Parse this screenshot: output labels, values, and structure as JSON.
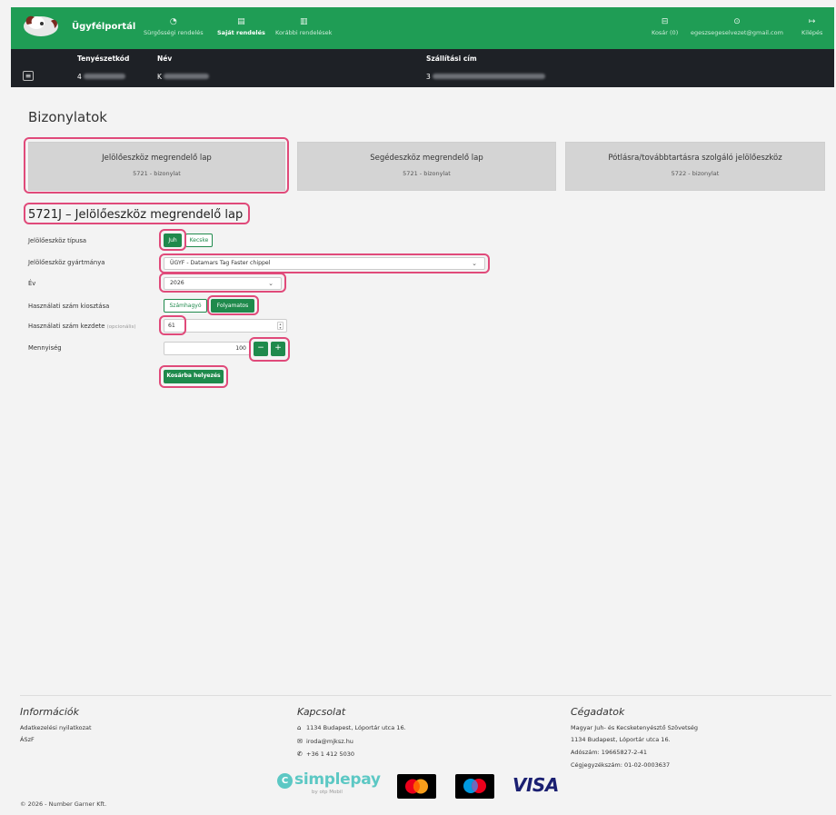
{
  "navbar": {
    "brand": "Ügyfélportál",
    "items": [
      {
        "label": "Sürgősségi rendelés",
        "icon": "clock-icon"
      },
      {
        "label": "Saját rendelés",
        "icon": "document-icon"
      },
      {
        "label": "Korábbi rendelések",
        "icon": "file-icon"
      }
    ],
    "right": [
      {
        "label": "Kosár (0)",
        "icon": "cart-icon"
      },
      {
        "label": "egeszsegeselvezet@gmail.com",
        "icon": "user-icon"
      },
      {
        "label": "Kilépés",
        "icon": "logout-icon"
      }
    ]
  },
  "infobar": {
    "headers": {
      "tenyeszetkod": "Tenyészetkód",
      "nev": "Név",
      "szallitasi": "Szállítási cím"
    },
    "values": {
      "tenyeszetkod": "4",
      "nev": "K",
      "szallitasi": "3"
    }
  },
  "page": {
    "title": "Bizonylatok"
  },
  "cards": [
    {
      "title": "Jelölőeszköz megrendelő lap",
      "subtitle": "5721 - bizonylat"
    },
    {
      "title": "Segédeszköz megrendelő lap",
      "subtitle": "5721 - bizonylat"
    },
    {
      "title": "Pótlásra/továbbtartásra szolgáló jelölőeszköz",
      "subtitle": "5722 - bizonylat"
    }
  ],
  "form": {
    "title": "5721J – Jelölőeszköz megrendelő lap",
    "tipus": {
      "label": "Jelölőeszköz típusa",
      "options": [
        "Juh",
        "Kecske"
      ],
      "selected": "Juh"
    },
    "gyartmany": {
      "label": "Jelölőeszköz gyártmánya",
      "value": "ÜGYF - Datamars Tag Faster chippel"
    },
    "ev": {
      "label": "Év",
      "value": "2026"
    },
    "kiosztas": {
      "label": "Használati szám kiosztása",
      "options": [
        "Számhagyó",
        "Folyamatos"
      ],
      "selected": "Folyamatos"
    },
    "kezdete": {
      "label": "Használati szám kezdete",
      "optional": "(opcionális)",
      "value": "61"
    },
    "mennyiseg": {
      "label": "Mennyiség",
      "value": "100",
      "minus": "−",
      "plus": "+"
    },
    "submit": "Kosárba helyezés"
  },
  "footer": {
    "info": {
      "title": "Információk",
      "links": [
        "Adatkezelési nyilatkozat",
        "ÁSzF"
      ]
    },
    "contact": {
      "title": "Kapcsolat",
      "address": "1134 Budapest, Lóportár utca 16.",
      "email": "iroda@mjksz.hu",
      "phone": "+36 1 412 5030"
    },
    "company": {
      "title": "Cégadatok",
      "lines": [
        "Magyar Juh- és Kecsketenyésztő Szövetség",
        "1134 Budapest, Lóportár utca 16.",
        "Adószám: 19665827-2-41",
        "Cégjegyzékszám: 01-02-0003637"
      ]
    },
    "copyright": "© 2026 - Number Garner Kft.",
    "payments": {
      "simplepay": "simplepay",
      "simplepay_by": "by otp Mobil",
      "visa": "VISA"
    }
  }
}
